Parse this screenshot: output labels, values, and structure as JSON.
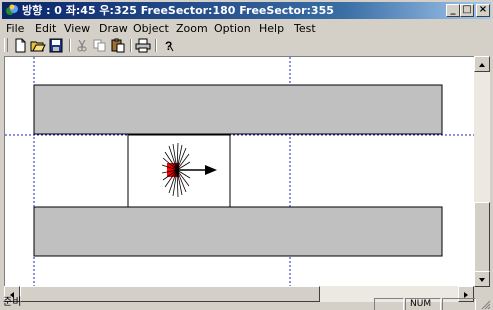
{
  "window": {
    "title": "방향 : 0 좌:45 우:325 FreeSector:180 FreeSector:355",
    "min_label": "_",
    "max_label": "□",
    "close_label": "×"
  },
  "menu": [
    {
      "label": "File"
    },
    {
      "label": "Edit"
    },
    {
      "label": "View"
    },
    {
      "label": "Draw"
    },
    {
      "label": "Object"
    },
    {
      "label": "Zoom"
    },
    {
      "label": "Option"
    },
    {
      "label": "Help"
    },
    {
      "label": "Test"
    }
  ],
  "toolbar": {
    "icons": [
      "new-icon",
      "open-icon",
      "save-icon",
      "cut-icon",
      "copy-icon",
      "paste-icon",
      "print-icon",
      "help-icon"
    ]
  },
  "canvas": {
    "grid_color": "#2020c0",
    "obstacle_fill": "#c0c0c0",
    "robot_color": "#ff0000",
    "heading_degrees": 0
  },
  "status": {
    "text": "준비",
    "num": "NUM"
  }
}
